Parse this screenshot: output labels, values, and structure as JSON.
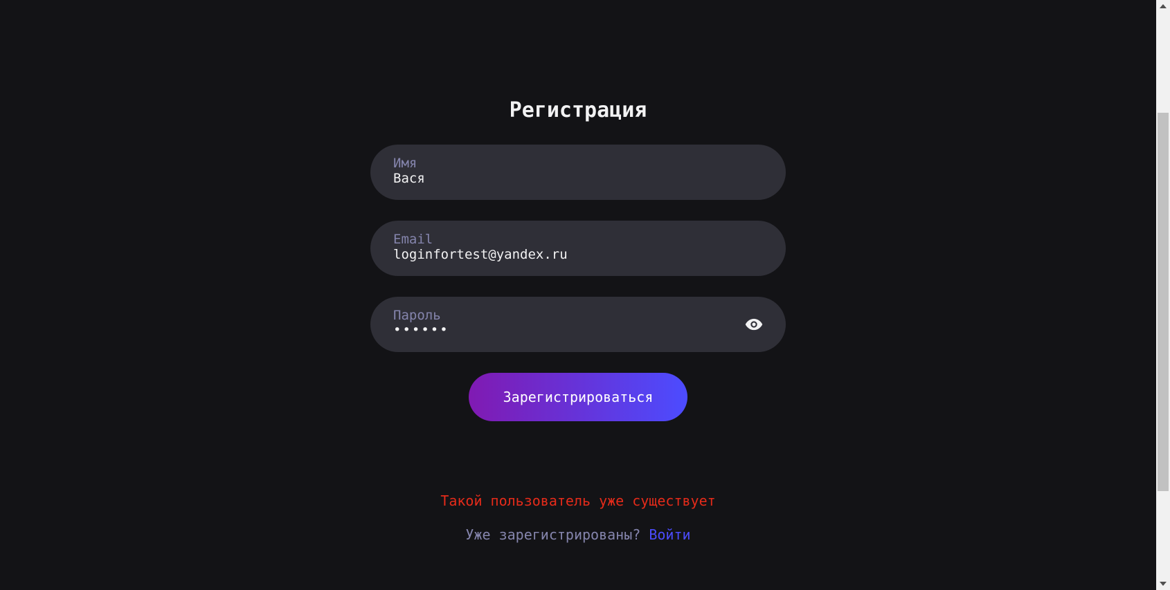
{
  "form": {
    "title": "Регистрация",
    "name_field": {
      "label": "Имя",
      "value": "Вася"
    },
    "email_field": {
      "label": "Email",
      "value": "loginfortest@yandex.ru"
    },
    "password_field": {
      "label": "Пароль",
      "value": "••••••",
      "toggle_icon": "eye-icon"
    },
    "submit_label": "Зарегистрироваться"
  },
  "error_message": "Такой пользователь уже существует",
  "login_prompt": {
    "text": "Уже зарегистрированы?",
    "link_label": "Войти"
  },
  "colors": {
    "background": "#131316",
    "input_background": "#2f2f37",
    "label": "#8585ad",
    "text": "#f2f2f3",
    "error": "#e52b1a",
    "link": "#4c4cff",
    "button_gradient_start": "#801ab2",
    "button_gradient_end": "#4c4cff"
  }
}
